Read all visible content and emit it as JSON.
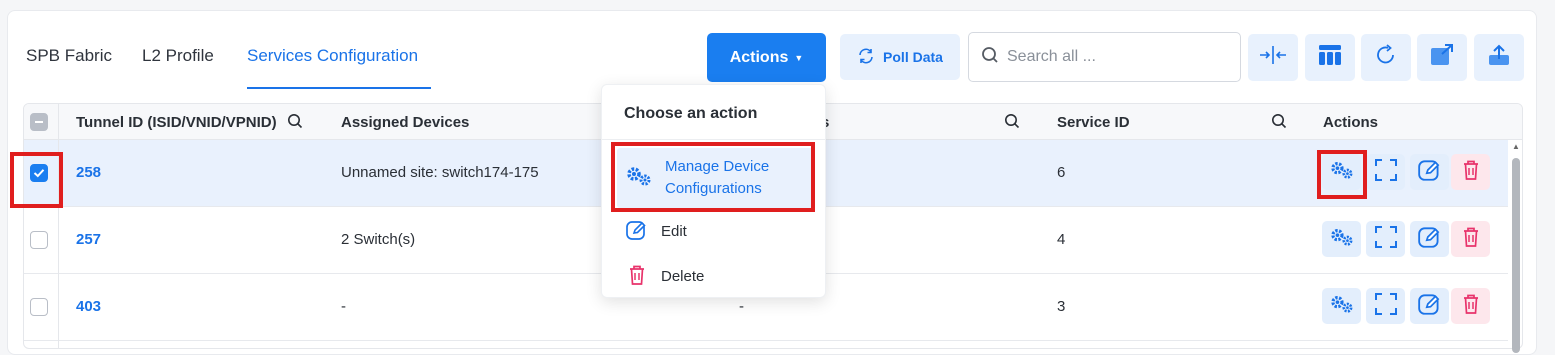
{
  "tabs": [
    {
      "label": "SPB Fabric",
      "active": false
    },
    {
      "label": "L2 Profile",
      "active": false
    },
    {
      "label": "Services Configuration",
      "active": true
    }
  ],
  "toolbar": {
    "actions_label": "Actions",
    "poll_label": "Poll Data",
    "search_placeholder": "Search all ...",
    "tools": [
      "collapse-columns-icon",
      "column-layout-icon",
      "refresh-icon",
      "open-external-icon",
      "export-upload-icon"
    ]
  },
  "table": {
    "columns": [
      "Tunnel ID (ISID/VNID/VPNID)",
      "Assigned Devices",
      "s",
      "Service ID",
      "Actions"
    ],
    "rows": [
      {
        "id": "258",
        "devices": "Unnamed site: switch174-175",
        "col3": "",
        "service_id": "6",
        "selected": true
      },
      {
        "id": "257",
        "devices": "2 Switch(s)",
        "col3": "",
        "service_id": "4",
        "selected": false
      },
      {
        "id": "403",
        "devices": "-",
        "col3": "-",
        "service_id": "3",
        "selected": false
      }
    ]
  },
  "dropdown": {
    "title": "Choose an action",
    "items": [
      {
        "label_line1": "Manage Device",
        "label_line2": "Configurations",
        "icon": "gears-icon"
      },
      {
        "label": "Edit",
        "icon": "edit-icon"
      },
      {
        "label": "Delete",
        "icon": "trash-icon"
      }
    ]
  },
  "colors": {
    "accent": "#1a7ef0",
    "highlight": "#e01e1e",
    "danger": "#e8336b"
  }
}
